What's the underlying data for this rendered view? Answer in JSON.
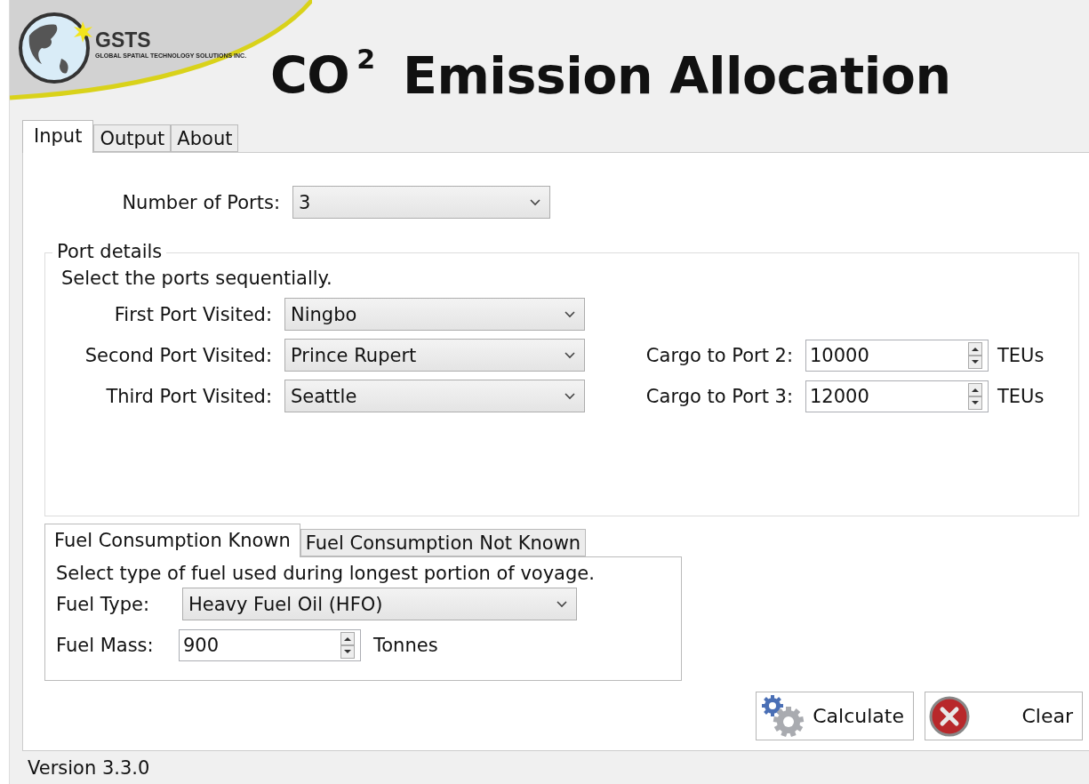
{
  "logo": {
    "name": "GSTS",
    "tagline": "GLOBAL SPATIAL TECHNOLOGY SOLUTIONS INC."
  },
  "title": "CO$^{2}$ Emission Allocation",
  "tabs": [
    {
      "label": "Input",
      "selected": true
    },
    {
      "label": "Output",
      "selected": false
    },
    {
      "label": "About",
      "selected": false
    }
  ],
  "number_of_ports": {
    "label": "Number of Ports:",
    "value": "3"
  },
  "port_details": {
    "title": "Port details",
    "hint": "Select the ports sequentially.",
    "ports": [
      {
        "label": "First Port Visited:",
        "value": "Ningbo"
      },
      {
        "label": "Second Port Visited:",
        "value": "Prince Rupert",
        "cargo": {
          "label": "Cargo to Port 2:",
          "value": "10000",
          "unit": "TEUs"
        }
      },
      {
        "label": "Third Port Visited:",
        "value": "Seattle",
        "cargo": {
          "label": "Cargo to Port 3:",
          "value": "12000",
          "unit": "TEUs"
        }
      }
    ]
  },
  "fuel_tabs": [
    {
      "label": "Fuel Consumption Known",
      "selected": true
    },
    {
      "label": "Fuel Consumption Not Known",
      "selected": false
    }
  ],
  "fuel": {
    "hint": "Select type of fuel used during longest portion of voyage.",
    "type_label": "Fuel Type:",
    "type_value": "Heavy Fuel Oil (HFO)",
    "mass_label": "Fuel Mass:",
    "mass_value": "900",
    "mass_unit": "Tonnes"
  },
  "buttons": [
    {
      "kind": "calculate",
      "label": "Calculate"
    },
    {
      "kind": "clear",
      "label": "Clear"
    }
  ],
  "status_bar": "Version 3.3.0"
}
